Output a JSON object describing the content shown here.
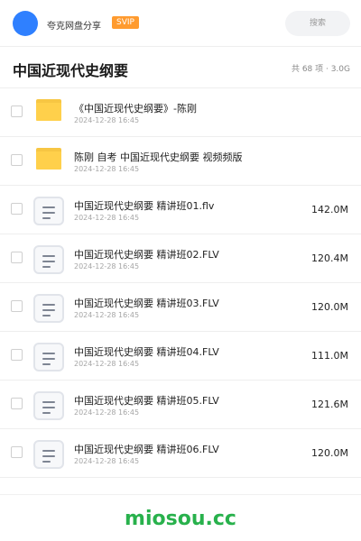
{
  "header": {
    "username": "夸克网盘分享",
    "badge": "SVIP",
    "search_placeholder": "搜索"
  },
  "folder": {
    "title": "中国近现代史纲要",
    "meta": "共 68 项 · 3.0G"
  },
  "items": [
    {
      "type": "folder",
      "name": "《中国近现代史纲要》-陈刚",
      "date": "2024-12-28 16:45",
      "size": ""
    },
    {
      "type": "folder",
      "name": "陈刚 自考 中国近现代史纲要 视频频版",
      "date": "2024-12-28 16:45",
      "size": ""
    },
    {
      "type": "file",
      "name": "中国近现代史纲要 精讲班01.flv",
      "date": "2024-12-28 16:45",
      "size": "142.0M"
    },
    {
      "type": "file",
      "name": "中国近现代史纲要 精讲班02.FLV",
      "date": "2024-12-28 16:45",
      "size": "120.4M"
    },
    {
      "type": "file",
      "name": "中国近现代史纲要 精讲班03.FLV",
      "date": "2024-12-28 16:45",
      "size": "120.0M"
    },
    {
      "type": "file",
      "name": "中国近现代史纲要 精讲班04.FLV",
      "date": "2024-12-28 16:45",
      "size": "111.0M"
    },
    {
      "type": "file",
      "name": "中国近现代史纲要 精讲班05.FLV",
      "date": "2024-12-28 16:45",
      "size": "121.6M"
    },
    {
      "type": "file",
      "name": "中国近现代史纲要 精讲班06.FLV",
      "date": "2024-12-28 16:45",
      "size": "120.0M"
    }
  ],
  "footer": {
    "watermark": "miosou.cc"
  },
  "colors": {
    "avatar": "#2f80ff",
    "badge": "#ff9b2f",
    "folder": "#ffd04b",
    "watermark": "#28b14c"
  }
}
